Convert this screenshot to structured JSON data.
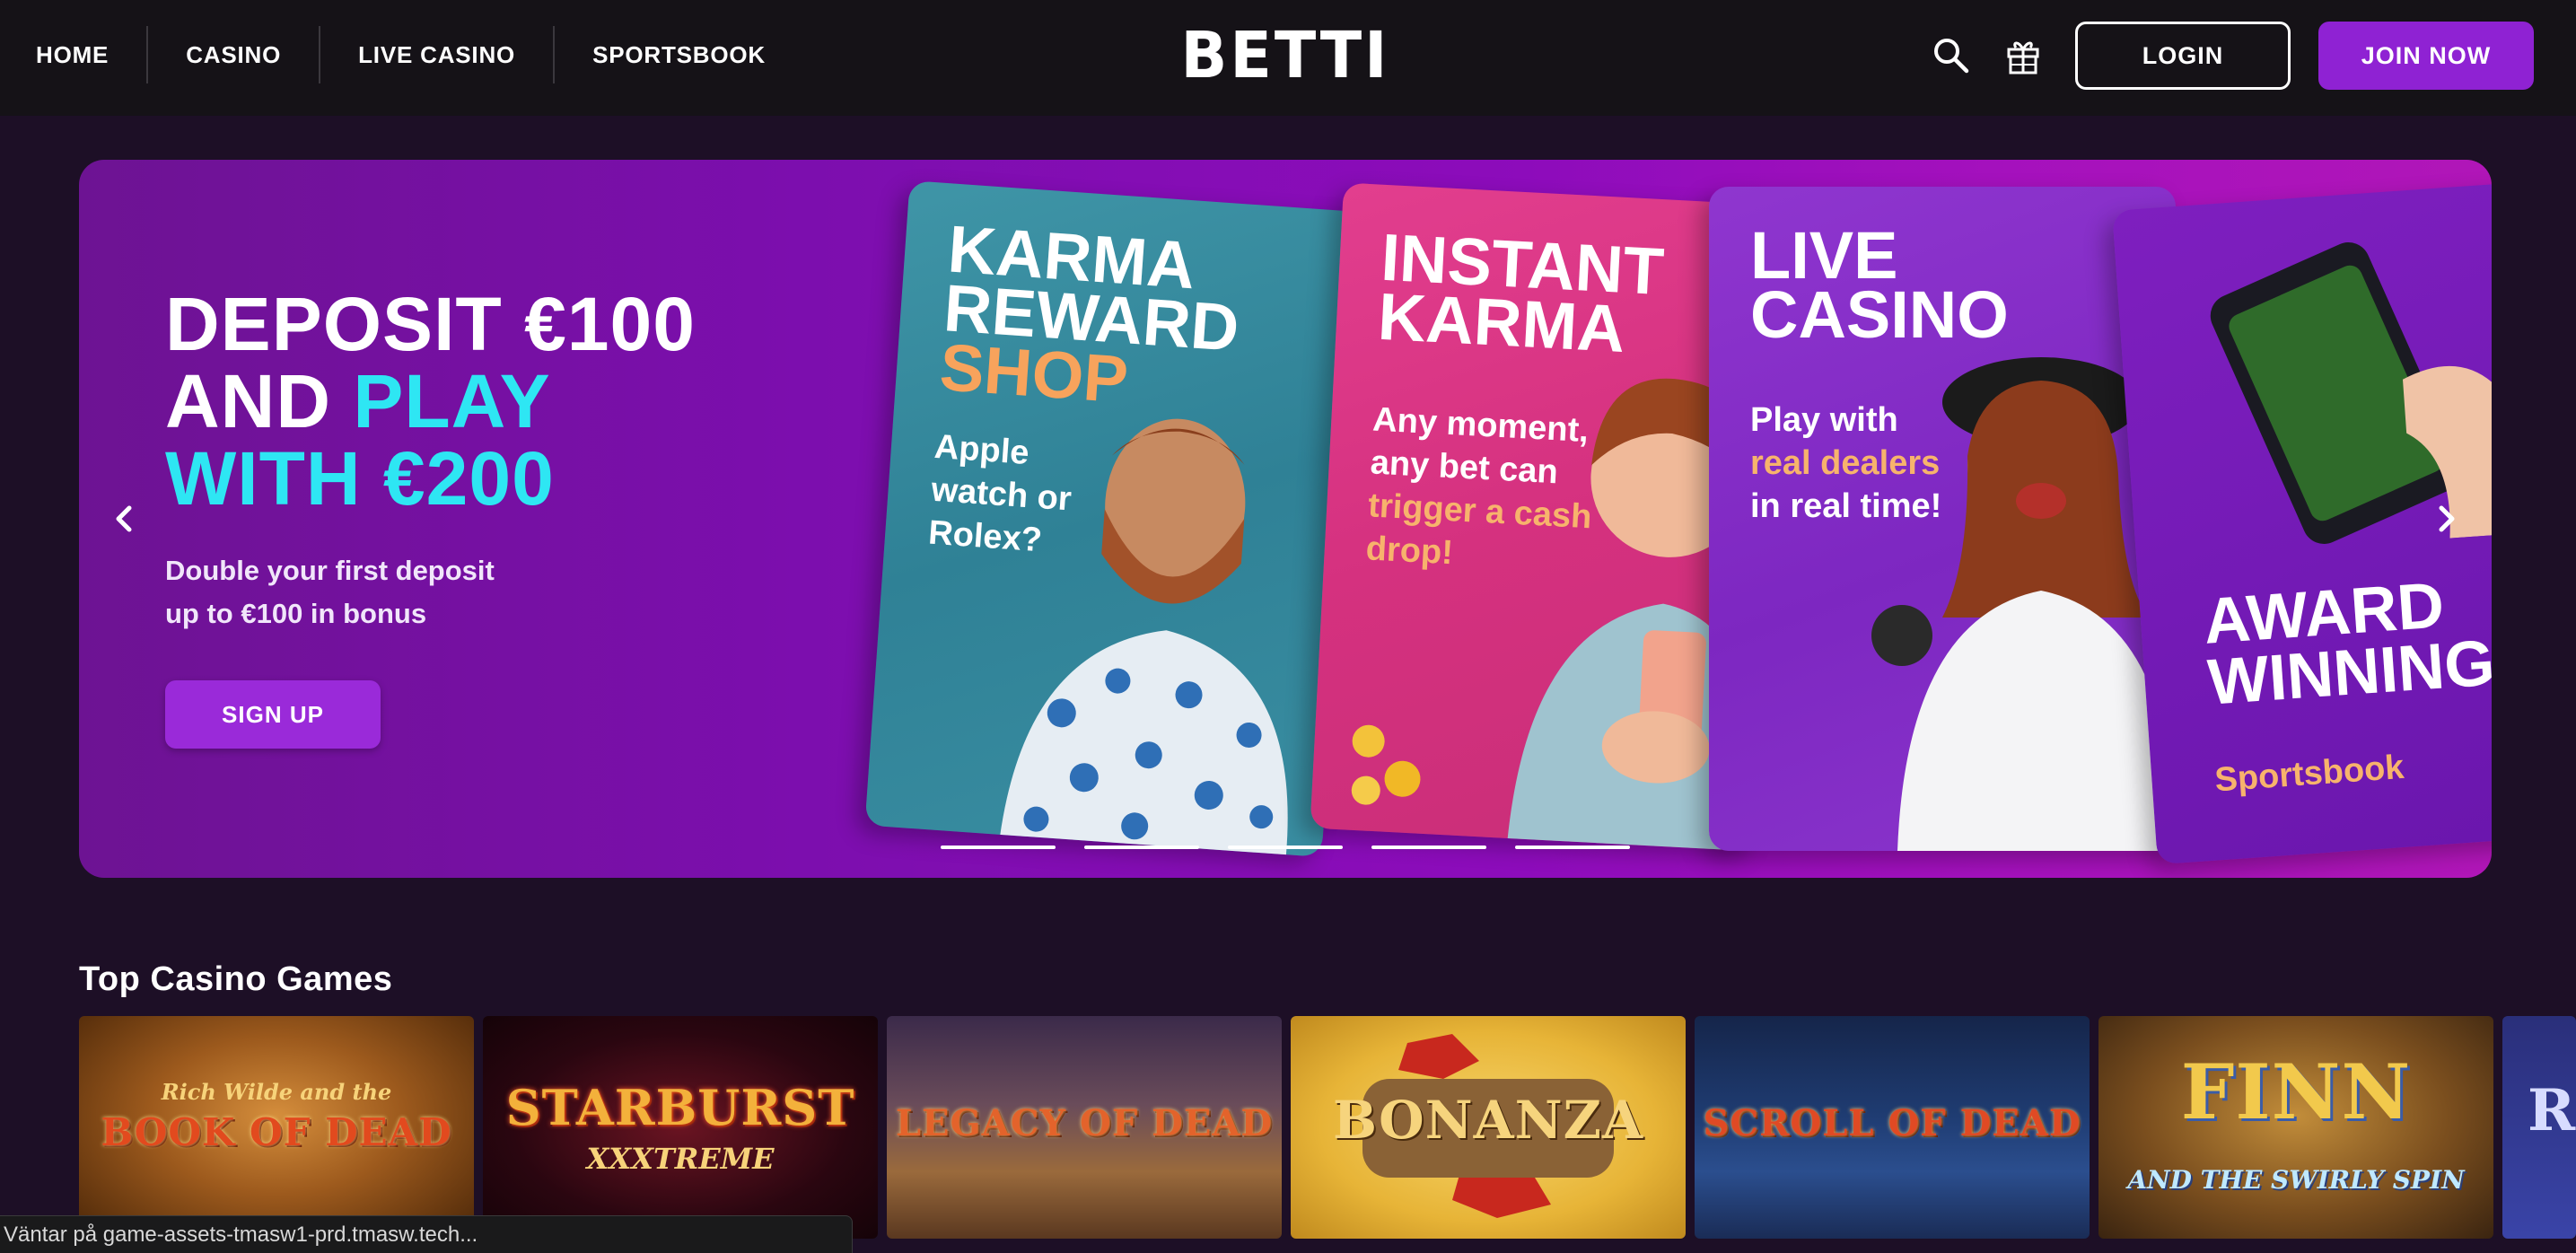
{
  "header": {
    "nav": [
      "HOME",
      "CASINO",
      "LIVE CASINO",
      "SPORTSBOOK"
    ],
    "logo": "BETTI",
    "search_icon": "search-icon",
    "gift_icon": "gift-icon",
    "login_label": "LOGIN",
    "join_label": "JOIN NOW"
  },
  "hero": {
    "title_line1": "DEPOSIT €100",
    "title_line2a": "AND ",
    "title_line2b": "PLAY",
    "title_line3": "WITH €200",
    "subtitle_line1": "Double your first deposit",
    "subtitle_line2": "up to €100 in bonus",
    "signup_label": "SIGN UP",
    "prev_icon": "chevron-left-icon",
    "next_icon": "chevron-right-icon",
    "slide_count": 5,
    "cards": [
      {
        "title": "KARMA REWARD",
        "title_accent": "SHOP",
        "body": "Apple watch or Rolex?"
      },
      {
        "title": "INSTANT KARMA",
        "body_a": "Any moment, any bet can ",
        "body_accent": "trigger a cash drop!"
      },
      {
        "title": "LIVE CASINO",
        "body_a": "Play with ",
        "body_accent": "real dealers",
        "body_b": "in real time!"
      },
      {
        "title": "AWARD WINNING",
        "body_accent": "Sportsbook"
      }
    ]
  },
  "games": {
    "section_title": "Top Casino Games",
    "tiles": [
      {
        "name": "BOOK OF DEAD",
        "sub": "Rich Wilde and the"
      },
      {
        "name": "STARBURST",
        "sub": "XXXTREME"
      },
      {
        "name": "LEGACY OF DEAD",
        "sub": ""
      },
      {
        "name": "BONANZA",
        "sub": ""
      },
      {
        "name": "SCROLL OF DEAD",
        "sub": ""
      },
      {
        "name": "FINN",
        "sub": "AND THE SWIRLY SPIN"
      },
      {
        "name": "R",
        "sub": ""
      }
    ]
  },
  "status_bar": "Väntar på game-assets-tmasw1-prd.tmasw.tech..."
}
